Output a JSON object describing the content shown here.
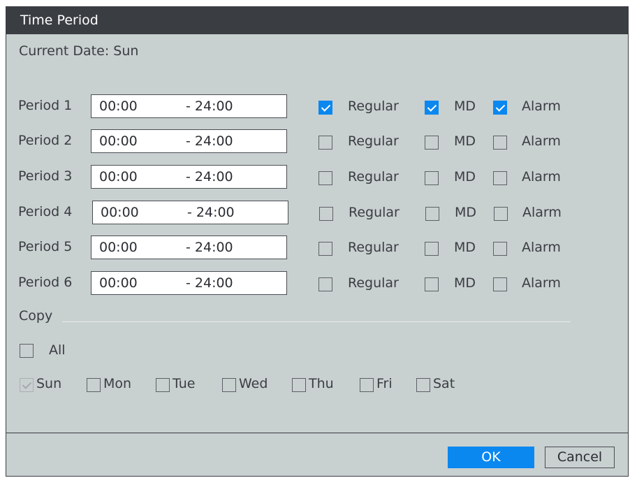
{
  "dialog": {
    "title": "Time Period",
    "current_date_label": "Current Date:",
    "current_date_value": "Sun"
  },
  "periods": [
    {
      "label": "Period 1",
      "start": "00:00",
      "end": "- 24:00",
      "regular": true,
      "md": true,
      "alarm": true
    },
    {
      "label": "Period 2",
      "start": "00:00",
      "end": "- 24:00",
      "regular": false,
      "md": false,
      "alarm": false
    },
    {
      "label": "Period 3",
      "start": "00:00",
      "end": "- 24:00",
      "regular": false,
      "md": false,
      "alarm": false
    },
    {
      "label": "Period 4",
      "start": "00:00",
      "end": "- 24:00",
      "regular": false,
      "md": false,
      "alarm": false
    },
    {
      "label": "Period 5",
      "start": "00:00",
      "end": "- 24:00",
      "regular": false,
      "md": false,
      "alarm": false
    },
    {
      "label": "Period 6",
      "start": "00:00",
      "end": "- 24:00",
      "regular": false,
      "md": false,
      "alarm": false
    }
  ],
  "labels": {
    "regular": "Regular",
    "md": "MD",
    "alarm": "Alarm"
  },
  "copy": {
    "label": "Copy",
    "all_label": "All",
    "days": [
      "Sun",
      "Mon",
      "Tue",
      "Wed",
      "Thu",
      "Fri",
      "Sat"
    ]
  },
  "buttons": {
    "ok": "OK",
    "cancel": "Cancel"
  },
  "colors": {
    "accent": "#0a88f0",
    "titlebar": "#3a3d42",
    "panel": "#c9d0d0"
  }
}
